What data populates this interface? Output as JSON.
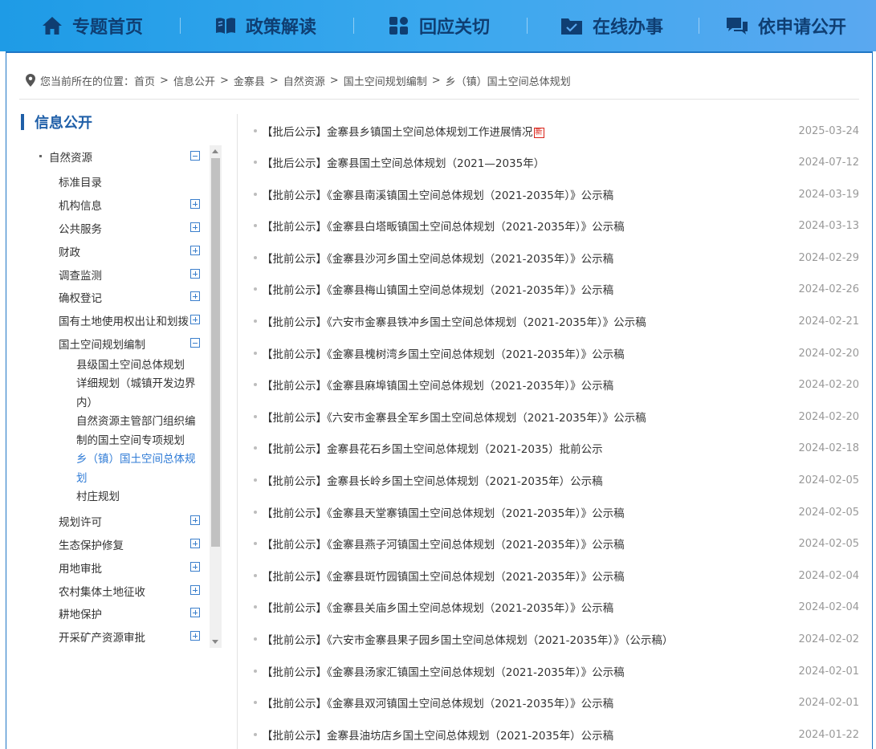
{
  "nav": {
    "items": [
      {
        "label": "专题首页",
        "icon": "home-icon"
      },
      {
        "label": "政策解读",
        "icon": "book-icon"
      },
      {
        "label": "回应关切",
        "icon": "grid-icon"
      },
      {
        "label": "在线办事",
        "icon": "folder-check-icon"
      },
      {
        "label": "依申请公开",
        "icon": "chat-icon"
      }
    ],
    "colors": {
      "bar_start": "#1e9be6",
      "bar_end": "#5aa8f0",
      "text": "#0f3e72"
    }
  },
  "breadcrumb": {
    "prefix": "您当前所在的位置：",
    "items": [
      "首页",
      "信息公开",
      "金寨县",
      "自然资源",
      "国土空间规划编制",
      "乡（镇）国土空间总体规划"
    ],
    "separator": ">"
  },
  "sidebar": {
    "title": "信息公开",
    "root": "自然资源",
    "items": [
      "标准目录",
      "机构信息",
      "公共服务",
      "财政",
      "调查监测",
      "确权登记",
      "国有土地使用权出让和划拨",
      "国土空间规划编制"
    ],
    "sub_items": [
      "县级国土空间总体规划",
      "详细规划（城镇开发边界内）",
      "自然资源主管部门组织编制的国土空间专项规划",
      "乡（镇）国土空间总体规划",
      "村庄规划"
    ],
    "items_after": [
      "规划许可",
      "生态保护修复",
      "用地审批",
      "农村集体土地征收",
      "耕地保护",
      "开采矿产资源审批"
    ],
    "accent": "#1f5fa8",
    "active_color": "#2f7bd6"
  },
  "list": {
    "new_badge": "新",
    "items": [
      {
        "title": "【批后公示】金寨县乡镇国土空间总体规划工作进展情况",
        "date": "2025-03-24",
        "is_new": true
      },
      {
        "title": "【批后公示】金寨县国土空间总体规划（2021—2035年）",
        "date": "2024-07-12"
      },
      {
        "title": "【批前公示】《金寨县南溪镇国土空间总体规划（2021-2035年）》公示稿",
        "date": "2024-03-19"
      },
      {
        "title": "【批前公示】《金寨县白塔畈镇国土空间总体规划（2021-2035年）》公示稿",
        "date": "2024-03-13"
      },
      {
        "title": "【批前公示】《金寨县沙河乡国土空间总体规划（2021-2035年）》公示稿",
        "date": "2024-02-29"
      },
      {
        "title": "【批前公示】《金寨县梅山镇国土空间总体规划（2021-2035年）》公示稿",
        "date": "2024-02-26"
      },
      {
        "title": "【批前公示】《六安市金寨县铁冲乡国土空间总体规划（2021-2035年）》公示稿",
        "date": "2024-02-21"
      },
      {
        "title": "【批前公示】《金寨县槐树湾乡国土空间总体规划（2021-2035年）》公示稿",
        "date": "2024-02-20"
      },
      {
        "title": "【批前公示】《金寨县麻埠镇国土空间总体规划（2021-2035年）》公示稿",
        "date": "2024-02-20"
      },
      {
        "title": "【批前公示】《六安市金寨县全军乡国土空间总体规划（2021-2035年）》公示稿",
        "date": "2024-02-20"
      },
      {
        "title": "【批前公示】金寨县花石乡国土空间总体规划（2021-2035）批前公示",
        "date": "2024-02-18"
      },
      {
        "title": "【批前公示】金寨县长岭乡国土空间总体规划（2021-2035年）公示稿",
        "date": "2024-02-05"
      },
      {
        "title": "【批前公示】《金寨县天堂寨镇国土空间总体规划（2021-2035年）》公示稿",
        "date": "2024-02-05"
      },
      {
        "title": "【批前公示】《金寨县燕子河镇国土空间总体规划（2021-2035年）》公示稿",
        "date": "2024-02-05"
      },
      {
        "title": "【批前公示】《金寨县斑竹园镇国土空间总体规划（2021-2035年）》公示稿",
        "date": "2024-02-04"
      },
      {
        "title": "【批前公示】《金寨县关庙乡国土空间总体规划（2021-2035年）》公示稿",
        "date": "2024-02-04"
      },
      {
        "title": "【批前公示】《六安市金寨县果子园乡国土空间总体规划（2021-2035年）》（公示稿）",
        "date": "2024-02-02"
      },
      {
        "title": "【批前公示】《金寨县汤家汇镇国土空间总体规划（2021-2035年）》公示稿",
        "date": "2024-02-01"
      },
      {
        "title": "【批前公示】《金寨县双河镇国土空间总体规划（2021-2035年）》公示稿",
        "date": "2024-02-01"
      },
      {
        "title": "【批前公示】金寨县油坊店乡国土空间总体规划（2021-2035年）公示稿",
        "date": "2024-01-22"
      }
    ]
  }
}
